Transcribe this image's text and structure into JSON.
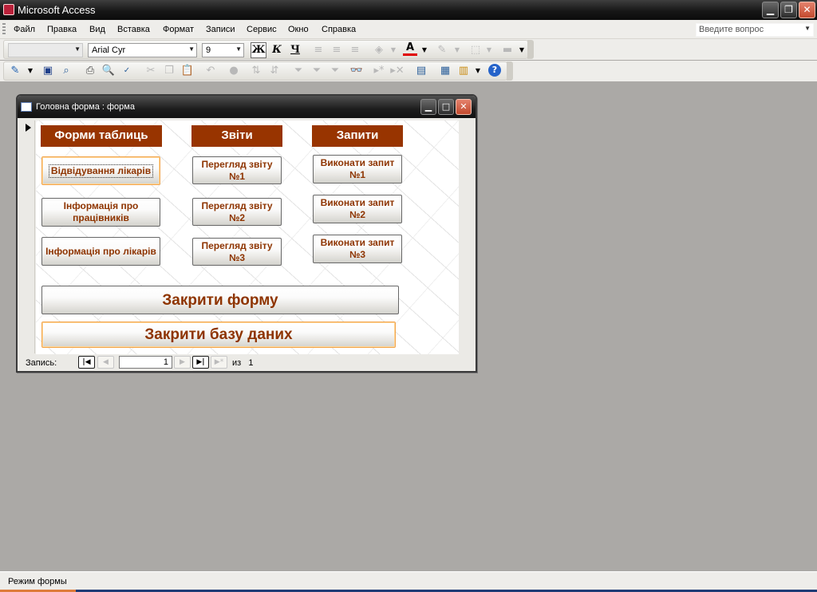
{
  "app": {
    "title": "Microsoft Access",
    "help_placeholder": "Введите вопрос"
  },
  "menu": [
    "Файл",
    "Правка",
    "Вид",
    "Вставка",
    "Формат",
    "Записи",
    "Сервис",
    "Окно",
    "Справка"
  ],
  "format_toolbar": {
    "object_combo": "",
    "font_name": "Arial Cyr",
    "font_size": "9",
    "bold": "Ж",
    "italic": "К",
    "underline": "Ч"
  },
  "form": {
    "title": "Головна форма : форма",
    "headers": [
      "Форми таблиць",
      "Звіти",
      "Запити"
    ],
    "table_forms": [
      "Відвідування лікарів",
      "Інформація про працівників",
      "Інформація про лікарів"
    ],
    "reports": [
      "Перегляд звіту №1",
      "Перегляд звіту №2",
      "Перегляд звіту №3"
    ],
    "queries": [
      "Виконати запит №1",
      "Виконати запит №2",
      "Виконати запит №3"
    ],
    "close_form": "Закрити форму",
    "close_db": "Закрити базу даних",
    "colors": {
      "header_bg": "#983400",
      "button_text": "#8e3400"
    }
  },
  "navigation": {
    "label": "Запись:",
    "current": "1",
    "of_label": "из",
    "total": "1"
  },
  "status": {
    "mode": "Режим формы"
  }
}
